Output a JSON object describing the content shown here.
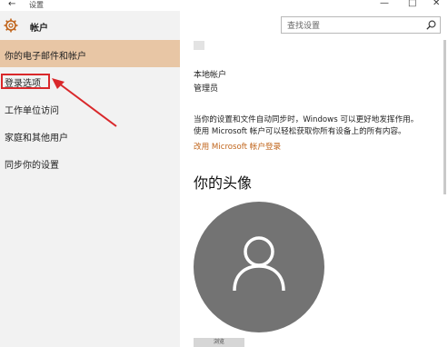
{
  "window": {
    "back_icon": "←",
    "title": "设置",
    "minimize": "—",
    "maximize": "□",
    "close": "✕"
  },
  "sidebar": {
    "header_label": "帐户",
    "items": [
      {
        "label": "你的电子邮件和帐户",
        "active": true
      },
      {
        "label": "登录选项",
        "active": false
      },
      {
        "label": "工作单位访问",
        "active": false
      },
      {
        "label": "家庭和其他用户",
        "active": false
      },
      {
        "label": "同步你的设置",
        "active": false
      }
    ]
  },
  "search": {
    "placeholder": "查找设置"
  },
  "account": {
    "type": "本地帐户",
    "role": "管理员",
    "desc_line1": "当你的设置和文件自动同步时，Windows 可以更好地发挥作用。",
    "desc_line2": "使用 Microsoft 帐户可以轻松获取你所有设备上的所有内容。",
    "link": "改用 Microsoft 帐户登录"
  },
  "avatar_section": {
    "title": "你的头像",
    "browse_label": "浏览"
  },
  "colors": {
    "accent": "#c0641a",
    "active_nav": "#e8c6a5",
    "annotation": "#d9282b",
    "avatar_bg": "#737373"
  },
  "icons": [
    "back-icon",
    "gear-icon",
    "search-icon",
    "user-icon",
    "annotation-arrow"
  ]
}
